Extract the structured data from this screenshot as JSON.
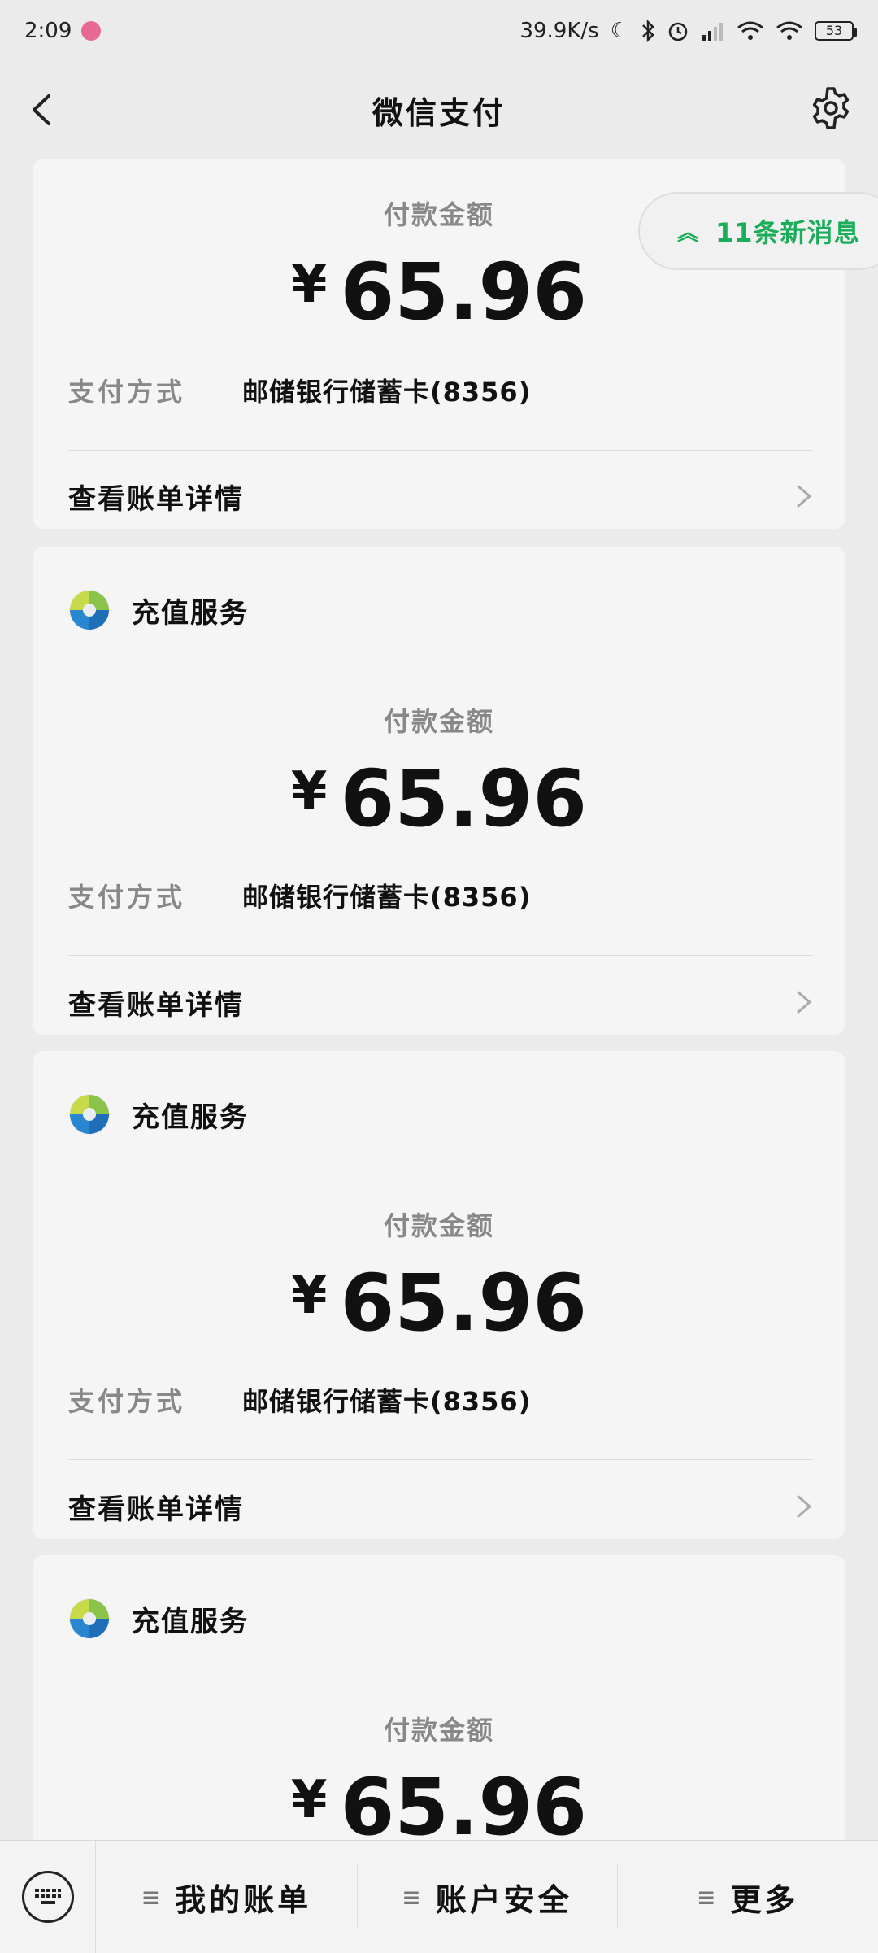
{
  "status_bar": {
    "time": "2:09",
    "net_speed": "39.9K/s",
    "battery": "53"
  },
  "nav": {
    "title": "微信支付"
  },
  "new_messages": {
    "label": "11条新消息"
  },
  "cards": [
    {
      "service_name": "",
      "amount_label": "付款金额",
      "currency": "¥",
      "amount": "65.96",
      "pay_method_label": "支付方式",
      "pay_method_value": "邮储银行储蓄卡(8356)",
      "detail_link": "查看账单详情"
    },
    {
      "service_name": "充值服务",
      "amount_label": "付款金额",
      "currency": "¥",
      "amount": "65.96",
      "pay_method_label": "支付方式",
      "pay_method_value": "邮储银行储蓄卡(8356)",
      "detail_link": "查看账单详情"
    },
    {
      "service_name": "充值服务",
      "amount_label": "付款金额",
      "currency": "¥",
      "amount": "65.96",
      "pay_method_label": "支付方式",
      "pay_method_value": "邮储银行储蓄卡(8356)",
      "detail_link": "查看账单详情"
    },
    {
      "service_name": "充值服务",
      "amount_label": "付款金额",
      "currency": "¥",
      "amount": "65.96"
    }
  ],
  "bottom_menu": {
    "items": [
      {
        "label": "我的账单"
      },
      {
        "label": "账户安全"
      },
      {
        "label": "更多"
      }
    ]
  },
  "colors": {
    "accent_green": "#1aad5a",
    "muted_text": "#888888",
    "card_bg": "#f5f5f5"
  }
}
